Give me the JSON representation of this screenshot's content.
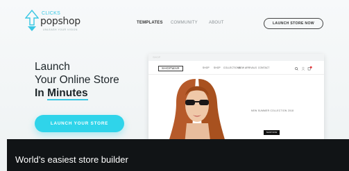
{
  "logo": {
    "prefix": "CLICKS",
    "name": "popshop",
    "tagline": "UNLEASH YOUR VISION"
  },
  "nav": {
    "items": [
      "TEMPLATES",
      "COMMUNITY",
      "ABOUT"
    ],
    "active": "TEMPLATES"
  },
  "header": {
    "cta_label": "LAUNCH STORE NOW"
  },
  "hero": {
    "line1": "Launch",
    "line2": "Your Online Store",
    "line3_prefix": "In ",
    "line3_highlight": "Minutes",
    "cta_label": "LAUNCH YOUR STORE"
  },
  "preview": {
    "bar_text": "SHOP",
    "shop_logo": "SHOPWAR",
    "nav_items": [
      "SHOP",
      "SHOP",
      "COLLECTIONS",
      "NEW ARRIVALS",
      "CONTACT"
    ],
    "collection_text": "NEW SUMMER COLLECTION 2018",
    "button_label": "SHOP NOW"
  },
  "caption": {
    "text": "World’s easiest store builder"
  },
  "colors": {
    "accent": "#2fd4ea",
    "caption_bg": "#111416",
    "text_dark": "#1d2529"
  }
}
